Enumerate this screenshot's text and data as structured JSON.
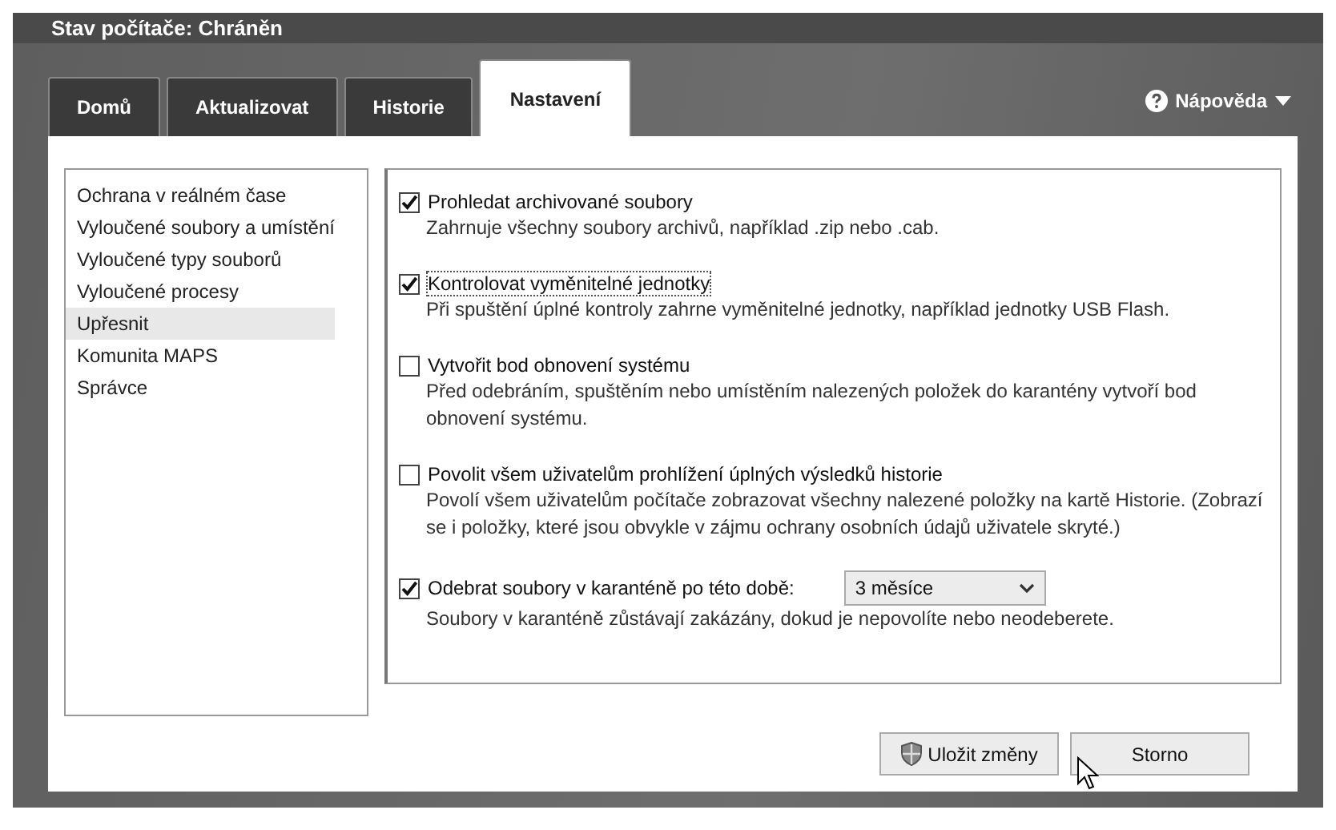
{
  "window": {
    "title": "Stav počítače: Chráněn"
  },
  "tabs": [
    {
      "label": "Domů",
      "selected": false
    },
    {
      "label": "Aktualizovat",
      "selected": false
    },
    {
      "label": "Historie",
      "selected": false
    },
    {
      "label": "Nastavení",
      "selected": true
    }
  ],
  "help": {
    "label": "Nápověda"
  },
  "sidebar": {
    "items": [
      {
        "label": "Ochrana v reálném čase",
        "selected": false
      },
      {
        "label": "Vyloučené soubory a umístění",
        "selected": false
      },
      {
        "label": "Vyloučené typy souborů",
        "selected": false
      },
      {
        "label": "Vyloučené procesy",
        "selected": false
      },
      {
        "label": "Upřesnit",
        "selected": true
      },
      {
        "label": "Komunita MAPS",
        "selected": false
      },
      {
        "label": "Správce",
        "selected": false
      }
    ]
  },
  "options": [
    {
      "label": "Prohledat archivované soubory",
      "checked": true,
      "focused": false,
      "description": "Zahrnuje všechny soubory archivů, například .zip nebo .cab."
    },
    {
      "label": "Kontrolovat vyměnitelné jednotky",
      "checked": true,
      "focused": true,
      "description": "Při spuštění úplné kontroly zahrne vyměnitelné jednotky, například jednotky USB Flash."
    },
    {
      "label": "Vytvořit bod obnovení systému",
      "checked": false,
      "focused": false,
      "description": "Před odebráním, spuštěním nebo umístěním nalezených položek do karantény vytvoří bod obnovení systému."
    },
    {
      "label": "Povolit všem uživatelům prohlížení úplných výsledků historie",
      "checked": false,
      "focused": false,
      "description": "Povolí všem uživatelům počítače zobrazovat všechny nalezené položky na kartě Historie. (Zobrazí se i položky, které jsou obvykle v zájmu ochrany osobních údajů uživatele skryté.)"
    },
    {
      "label": "Odebrat soubory v karanténě po této době:",
      "checked": true,
      "focused": false,
      "dropdown": "3 měsíce",
      "description": "Soubory v karanténě zůstávají zakázány, dokud je nepovolíte nebo neodeberete."
    }
  ],
  "buttons": [
    {
      "label": "Uložit změny",
      "shield": true
    },
    {
      "label": "Storno",
      "shield": false
    }
  ]
}
